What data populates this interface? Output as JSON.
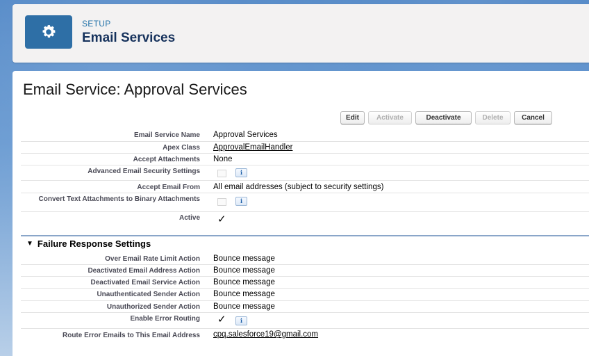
{
  "header": {
    "setup_label": "SETUP",
    "title": "Email Services",
    "icon": "gear-icon"
  },
  "page": {
    "title": "Email Service: Approval Services"
  },
  "buttons": {
    "edit": "Edit",
    "activate": "Activate",
    "deactivate": "Deactivate",
    "delete": "Delete",
    "cancel": "Cancel"
  },
  "details": {
    "email_service_name": {
      "label": "Email Service Name",
      "value": "Approval Services"
    },
    "apex_class": {
      "label": "Apex Class",
      "value": "ApprovalEmailHandler"
    },
    "accept_attachments": {
      "label": "Accept Attachments",
      "value": "None"
    },
    "advanced_security": {
      "label": "Advanced Email Security Settings",
      "checked": false
    },
    "accept_email_from": {
      "label": "Accept Email From",
      "value": "All email addresses (subject to security settings)"
    },
    "convert_text": {
      "label": "Convert Text Attachments to Binary Attachments",
      "checked": false
    },
    "active": {
      "label": "Active",
      "checked": true
    }
  },
  "failure_section": {
    "title": "Failure Response Settings",
    "over_rate_limit": {
      "label": "Over Email Rate Limit Action",
      "value": "Bounce message"
    },
    "deactivated_address": {
      "label": "Deactivated Email Address Action",
      "value": "Bounce message"
    },
    "deactivated_service": {
      "label": "Deactivated Email Service Action",
      "value": "Bounce message"
    },
    "unauthenticated": {
      "label": "Unauthenticated Sender Action",
      "value": "Bounce message"
    },
    "unauthorized": {
      "label": "Unauthorized Sender Action",
      "value": "Bounce message"
    },
    "enable_error_routing": {
      "label": "Enable Error Routing",
      "checked": true
    },
    "route_error_emails": {
      "label": "Route Error Emails to This Email Address",
      "value": "cpq.salesforce19@gmail.com"
    }
  },
  "info_glyph": "i",
  "check_glyph": "✓",
  "colors": {
    "header_icon_bg": "#2e6fa6",
    "link_blue": "#2574a9",
    "section_divider": "#8aa6c9"
  }
}
